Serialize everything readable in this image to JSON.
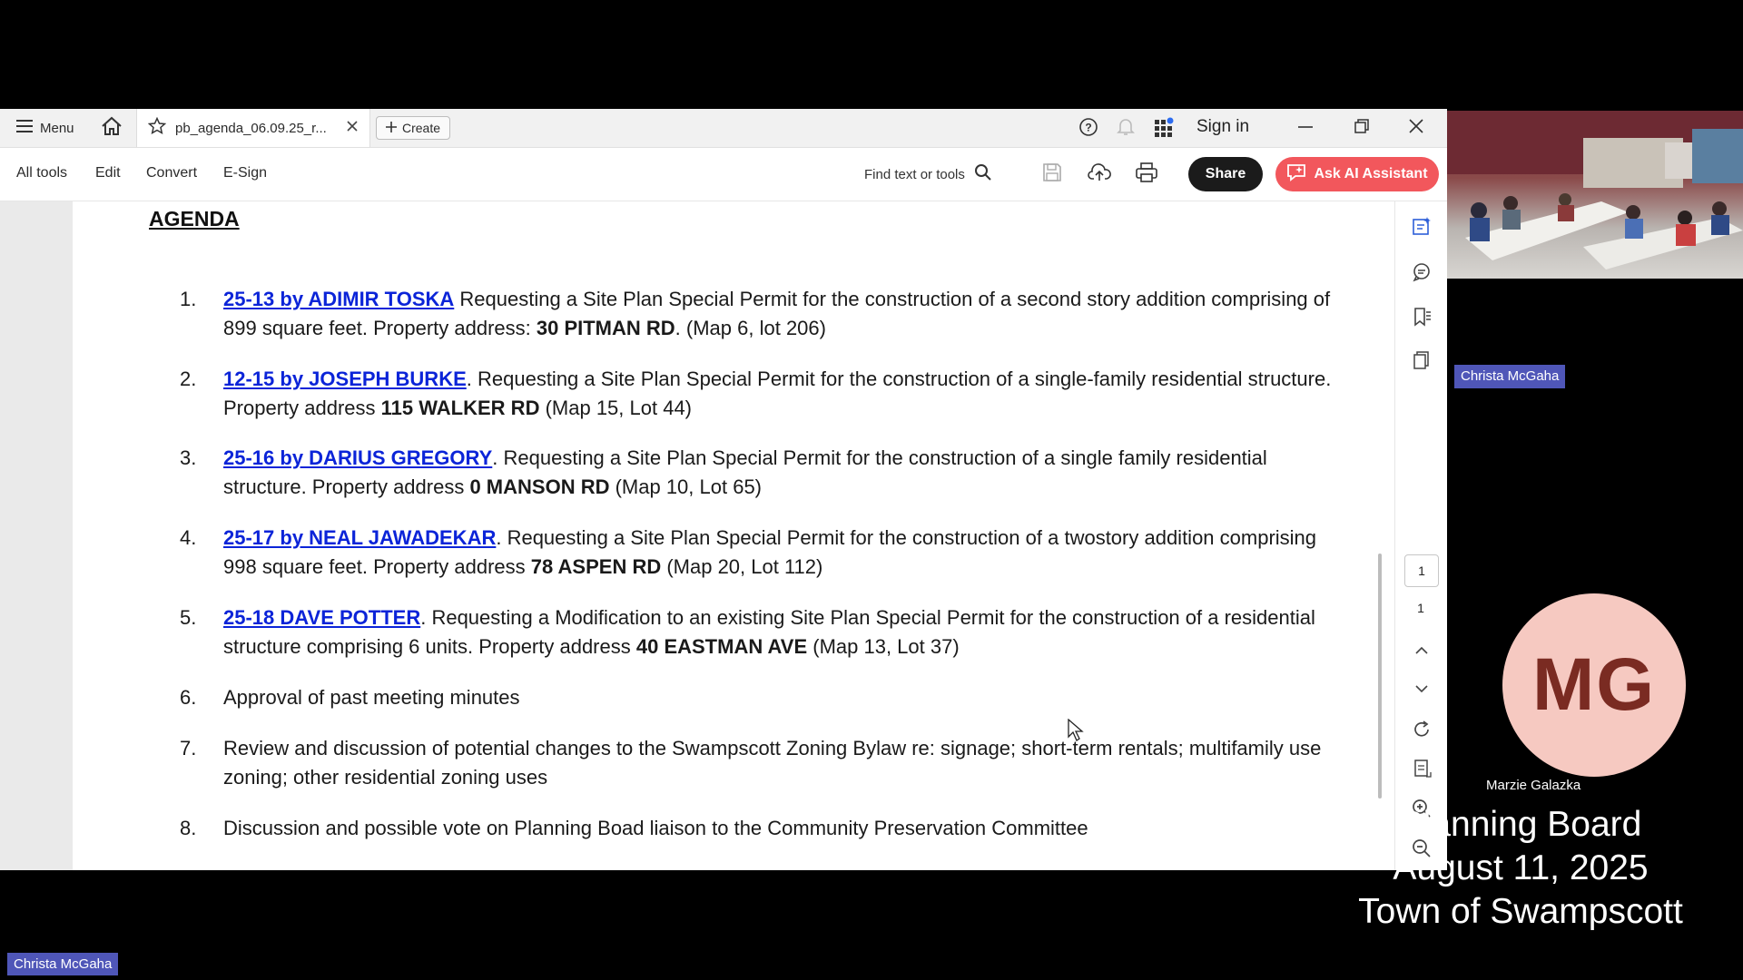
{
  "app": {
    "tab_bar": {
      "menu_label": "Menu",
      "tab_name": "pb_agenda_06.09.25_r...",
      "create_label": "Create",
      "signin_label": "Sign in"
    },
    "toolbar": {
      "items": [
        "All tools",
        "Edit",
        "Convert",
        "E-Sign"
      ],
      "find_placeholder": "Find text or tools",
      "share_label": "Share",
      "ai_label": "Ask AI Assistant"
    },
    "colors": {
      "share_bg": "#1b1b1b",
      "ai_bg": "#f2575c",
      "link": "#0b24d8"
    }
  },
  "document": {
    "heading": "AGENDA",
    "items": [
      {
        "num": "1.",
        "link": "25-13 by ADIMIR TOSKA",
        "text1": " Requesting a Site Plan Special Permit for the construction of a second story addition comprising of 899 square feet.  Property address: ",
        "bold": "30 PITMAN RD",
        "text2": ". (Map 6, lot 206)"
      },
      {
        "num": "2.",
        "link": "12-15 by JOSEPH BURKE",
        "text1": ".  Requesting a Site Plan Special Permit for the construction of a single-family residential structure. Property address ",
        "bold": "115 WALKER RD",
        "text2": " (Map 15, Lot 44)"
      },
      {
        "num": "3.",
        "link": "25-16 by DARIUS GREGORY",
        "text1": ". Requesting a Site Plan Special Permit for the construction of a single family residential structure. Property address ",
        "bold": "0 MANSON RD",
        "text2": " (Map 10, Lot 65)"
      },
      {
        "num": "4.",
        "link": "25-17 by NEAL JAWADEKAR",
        "text1": ". Requesting a Site Plan Special Permit for the construction of a twostory addition comprising 998 square feet. Property address ",
        "bold": "78 ASPEN RD",
        "text2": " (Map 20, Lot 112)"
      },
      {
        "num": "5.",
        "link": "25-18 DAVE POTTER",
        "text1": ". Requesting a Modification to an existing Site Plan Special Permit for the construction of a residential structure comprising 6 units. Property address ",
        "bold": "40 EASTMAN AVE",
        "text2": " (Map 13, Lot 37)"
      },
      {
        "num": "6.",
        "text": "Approval of past meeting minutes"
      },
      {
        "num": "7.",
        "text": "Review and discussion of potential changes to the Swampscott Zoning Bylaw re: signage; short-term rentals; multifamily use zoning; other residential zoning uses"
      },
      {
        "num": "8.",
        "text": "Discussion and possible vote on Planning Boad liaison to the Community Preservation Committee"
      }
    ]
  },
  "page_nav": {
    "current": "1",
    "total": "1"
  },
  "meeting": {
    "video_name": "Christa McGaha",
    "avatar_initials": "MG",
    "participant_name": "Marzie Galazka",
    "overlay_line1": "Planning Board",
    "overlay_line2": "August 11, 2025",
    "overlay_line3": "Town of Swampscott",
    "bottom_name": "Christa McGaha",
    "avatar_color": "#f6c9c1"
  }
}
